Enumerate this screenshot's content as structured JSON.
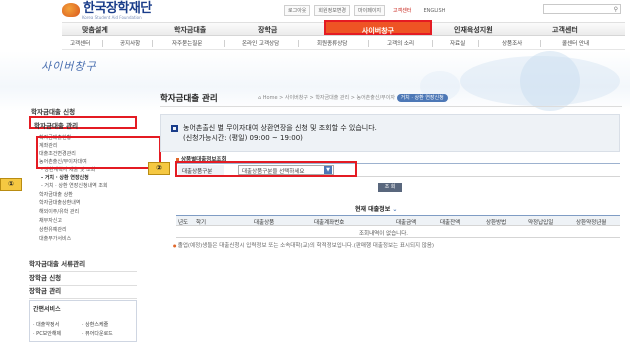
{
  "header": {
    "logo_text": "한국장학재단",
    "logo_sub": "Korea Student Aid Foundation",
    "util_links": [
      {
        "label": "로그아웃",
        "style": "box"
      },
      {
        "label": "회원정보변경",
        "style": "box"
      },
      {
        "label": "마이페이지",
        "style": "box"
      },
      {
        "label": "고객센터",
        "style": "red"
      },
      {
        "label": "ENGLISH",
        "style": "plain"
      }
    ]
  },
  "gnb": {
    "items": [
      "맞춤설계",
      "학자금대출",
      "장학금",
      "사이버창구",
      "인재육성지원",
      "고객센터"
    ],
    "active_index": 3
  },
  "subnav": {
    "items": [
      "고객센터",
      "공지사항",
      "자주묻는질문",
      "온라인 고객상담",
      "회원종류상담",
      "고객의 소리",
      "자료실",
      "상품조사",
      "콜센터 안내"
    ]
  },
  "hero": {
    "title": "사이버창구"
  },
  "lnb": {
    "heading": "학자금대출 신청",
    "active": "학자금대출 관리",
    "subs": [
      "학자금대출현황",
      "계좌관리",
      "대출조건변경관리",
      "농어촌출신/무이자대여",
      "- 상환계획서 제출 및 조회",
      "- 거치 · 상환 연장신청",
      "- 거치 · 상환 연장신청내역 조회",
      "학자금대출 상환",
      "학자금대출상환내역",
      "해외이주/유학 관리",
      "채무자신고",
      "상환유예관리",
      "대출부가서비스"
    ],
    "major": [
      "학자금대출 서류관리",
      "장학금 신청",
      "장학금 관리"
    ],
    "quick": {
      "title": "간편서비스",
      "links": [
        "· 대출약정서",
        "· 상환스케줄",
        "· PC보안해제",
        "· 뷰어다운로드"
      ]
    }
  },
  "badges": [
    "①",
    "②"
  ],
  "content": {
    "title": "학자금대출 관리",
    "breadcrumb": [
      "Home",
      "사이버창구",
      "학자금대출 관리",
      "농어촌출신/무이자",
      "거치 · 상환 연장신청"
    ],
    "notice": {
      "line1": "농어촌출신 별 무이자대여 상환연장을 신청 및 조회할 수 있습니다.",
      "line2": "(신청가능시간: (평일) 09:00 ~ 19:00)"
    },
    "section_title": "상품별대출정보조회",
    "form": {
      "label": "대출상품구분",
      "select_value": "대출상품구분을 선택하세요"
    },
    "query_button": "조 회",
    "table": {
      "title": "현재 대출정보",
      "headers": [
        "년도",
        "학기",
        "대출상품",
        "대출계좌번호",
        "대출금액",
        "대출잔액",
        "상환방법",
        "약정납입일",
        "상환약정년월"
      ],
      "empty": "조회내역이 없습니다."
    },
    "footnote": "졸업(예정)생들은 대출신청시 입력정보 또는 소속대학(교)의 학적정보입니다.(판매행 대출정보는 표시되지 않음)"
  }
}
